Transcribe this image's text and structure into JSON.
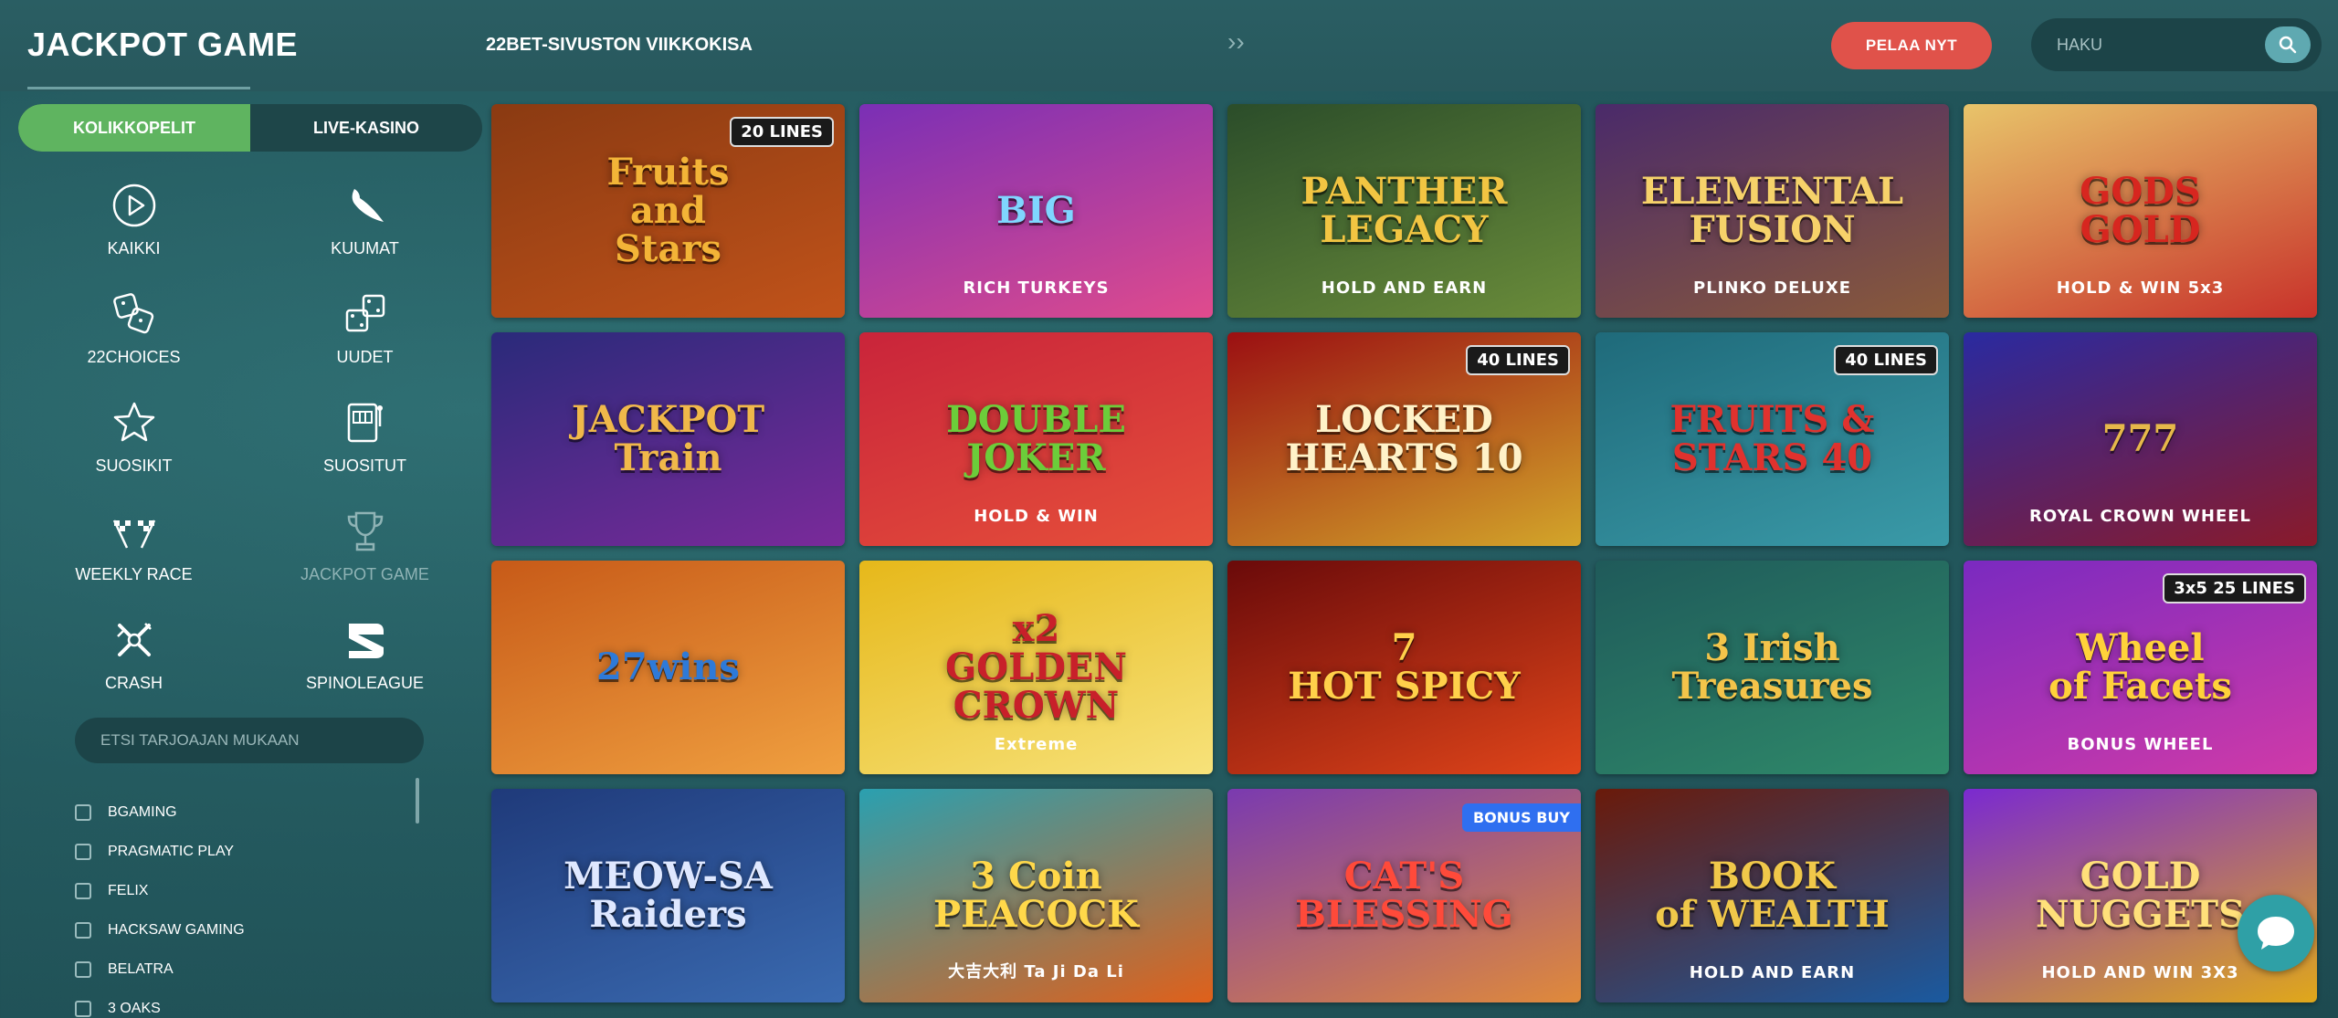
{
  "header": {
    "logo": "JACKPOT GAME",
    "promo": "22BET-SIVUSTON VIIKKOKISA",
    "promo_arrows": "››",
    "play_button": "PELAA NYT",
    "search_placeholder": "HAKU"
  },
  "sidebar": {
    "tabs": [
      {
        "label": "KOLIKKOPELIT",
        "active": true
      },
      {
        "label": "LIVE-KASINO",
        "active": false
      }
    ],
    "categories": [
      {
        "label": "KAIKKI",
        "icon": "play-circle-icon"
      },
      {
        "label": "KUUMAT",
        "icon": "chili-icon"
      },
      {
        "label": "22CHOICES",
        "icon": "dice-icon"
      },
      {
        "label": "UUDET",
        "icon": "new-dice-icon"
      },
      {
        "label": "SUOSIKIT",
        "icon": "star-icon"
      },
      {
        "label": "SUOSITUT",
        "icon": "slot-machine-icon"
      },
      {
        "label": "WEEKLY RACE",
        "icon": "race-flags-icon"
      },
      {
        "label": "JACKPOT GAME",
        "icon": "trophy-icon"
      },
      {
        "label": "CRASH",
        "icon": "crash-icon"
      },
      {
        "label": "SPINOLEAGUE",
        "icon": "spinoleague-icon"
      }
    ],
    "provider_search_placeholder": "ETSI TARJOAJAN MUKAAN",
    "providers": [
      "BGAMING",
      "PRAGMATIC PLAY",
      "FELIX",
      "HACKSAW GAMING",
      "BELATRA",
      "3 OAKS"
    ]
  },
  "games": [
    {
      "title": "Fruits\nand\nStars",
      "sub": "",
      "badge": "20 LINES",
      "bg": "#8a3a12",
      "bg2": "#c1531a",
      "color": "#f3b437"
    },
    {
      "title": "BIG",
      "sub": "RICH TURKEYS",
      "badge": "",
      "bg": "#7a2fb5",
      "bg2": "#e04b8d",
      "color": "#7fd6ff"
    },
    {
      "title": "PANTHER\nLEGACY",
      "sub": "HOLD AND EARN",
      "badge": "",
      "bg": "#2b4d2a",
      "bg2": "#6a8c3a",
      "color": "#f2c542"
    },
    {
      "title": "ELEMENTAL\nFUSION",
      "sub": "PLINKO DELUXE",
      "badge": "",
      "bg": "#4a2a6a",
      "bg2": "#8a5a3a",
      "color": "#f6d26a"
    },
    {
      "title": "GODS\nGOLD",
      "sub": "HOLD & WIN 5x3",
      "badge": "",
      "bg": "#e8c46a",
      "bg2": "#c8322a",
      "color": "#d7261f"
    },
    {
      "title": "JACKPOT\nTrain",
      "sub": "",
      "badge": "",
      "bg": "#2a2a7a",
      "bg2": "#7a2a9a",
      "color": "#f0b84a"
    },
    {
      "title": "DOUBLE\nJOKER",
      "sub": "HOLD & WIN",
      "badge": "",
      "bg": "#c9243a",
      "bg2": "#e6503a",
      "color": "#6ccd3a"
    },
    {
      "title": "LOCKED\nHEARTS 10",
      "sub": "",
      "badge": "40 LINES",
      "bg": "#9b0f12",
      "bg2": "#d3a62a",
      "color": "#fff2c8"
    },
    {
      "title": "FRUITS &\nSTARS 40",
      "sub": "",
      "badge": "40 LINES",
      "bg": "#1f6a7a",
      "bg2": "#3a9aa8",
      "color": "#e0322e"
    },
    {
      "title": "777",
      "sub": "ROYAL CROWN WHEEL",
      "badge": "",
      "bg": "#2a2aa0",
      "bg2": "#8a1a2a",
      "color": "#e6b84a"
    },
    {
      "title": "27wins",
      "sub": "",
      "badge": "",
      "bg": "#c75a18",
      "bg2": "#f0a040",
      "color": "#2e7ad8"
    },
    {
      "title": "x2\nGOLDEN CROWN",
      "sub": "Extreme",
      "badge": "",
      "bg": "#e6b81a",
      "bg2": "#f7e27a",
      "color": "#c8202a"
    },
    {
      "title": "7\nHOT SPICY",
      "sub": "",
      "badge": "",
      "bg": "#6a0a0a",
      "bg2": "#e0451a",
      "color": "#ffd04a"
    },
    {
      "title": "3 Irish\nTreasures",
      "sub": "",
      "badge": "",
      "bg": "#1f5a5a",
      "bg2": "#2f8a6a",
      "color": "#f3c44a"
    },
    {
      "title": "Wheel\nof Facets",
      "sub": "BONUS WHEEL",
      "badge": "3x5 25 LINES",
      "bg": "#7a2ac0",
      "bg2": "#d03aa8",
      "color": "#ffd23a"
    },
    {
      "title": "MEOW-SA\nRaiders",
      "sub": "",
      "badge": "",
      "bg": "#1f3a7a",
      "bg2": "#3a6ab0",
      "color": "#dfe8ff"
    },
    {
      "title": "3 Coin\nPEACOCK",
      "sub": "大吉大利 Ta Ji Da Li",
      "badge": "",
      "bg": "#2aa0b0",
      "bg2": "#e0601a",
      "color": "#ffd84a"
    },
    {
      "title": "CAT'S\nBLESSING",
      "sub": "",
      "badge": "BONUS BUY",
      "bg": "#7a3ab0",
      "bg2": "#e08a3a",
      "color": "#ff4a3a"
    },
    {
      "title": "BOOK\nof WEALTH",
      "sub": "HOLD AND EARN",
      "badge": "",
      "bg": "#6a1a0a",
      "bg2": "#1a5aa0",
      "color": "#f0c84a"
    },
    {
      "title": "GOLD\nNUGGETS",
      "sub": "HOLD AND WIN 3X3",
      "badge": "",
      "bg": "#7a2ad0",
      "bg2": "#e0a81a",
      "color": "#ffe07a"
    }
  ]
}
